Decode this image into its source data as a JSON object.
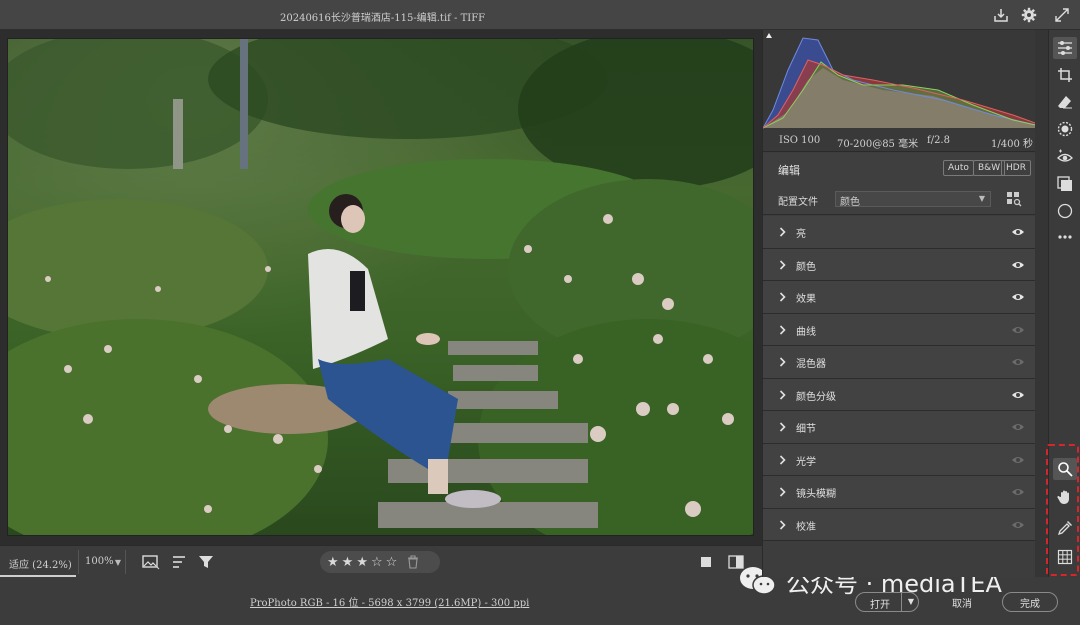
{
  "window": {
    "title": "20240616长沙普瑞酒店-115-编辑.tif -  TIFF"
  },
  "image": {
    "description_icon": "photo-preview"
  },
  "image_toolbar": {
    "fit_label": "适应 (24.2%)",
    "zoom_value": "100%",
    "rating": {
      "filled": 3,
      "total": 5
    }
  },
  "histogram": {
    "iso": "ISO 100",
    "lens": "70-200@85 毫米",
    "aperture": "f/2.8",
    "shutter": "1/400 秒"
  },
  "edit_panel": {
    "title": "编辑",
    "auto_label": "Auto",
    "bw_label": "B&W",
    "hdr_label": "HDR",
    "profile_label": "配置文件",
    "profile_value": "颜色",
    "sections": [
      {
        "label": "亮",
        "eye_active": true
      },
      {
        "label": "颜色",
        "eye_active": true
      },
      {
        "label": "效果",
        "eye_active": true
      },
      {
        "label": "曲线",
        "eye_active": false
      },
      {
        "label": "混色器",
        "eye_active": false
      },
      {
        "label": "颜色分级",
        "eye_active": true
      },
      {
        "label": "细节",
        "eye_active": false
      },
      {
        "label": "光学",
        "eye_active": false
      },
      {
        "label": "镜头模糊",
        "eye_active": false
      },
      {
        "label": "校准",
        "eye_active": false
      }
    ]
  },
  "status": {
    "info": "ProPhoto RGB - 16 位 - 5698 x 3799 (21.6MP) - 300 ppi",
    "open_label": "打开",
    "cancel_label": "取消",
    "done_label": "完成"
  },
  "watermark": {
    "text": "公众号 · mediaTEA"
  },
  "colors": {
    "highlight_box": "#d7262b",
    "panel_bg": "#3d3d3d",
    "toolbar_bg": "#454545"
  },
  "tools": {
    "icons": [
      "sliders-icon",
      "crop-icon",
      "eraser-icon",
      "masking-icon",
      "redeye-icon",
      "presets-icon",
      "snapshots-icon",
      "more-icon",
      "zoom-icon",
      "hand-icon",
      "eyedropper-icon",
      "grid-icon"
    ]
  }
}
